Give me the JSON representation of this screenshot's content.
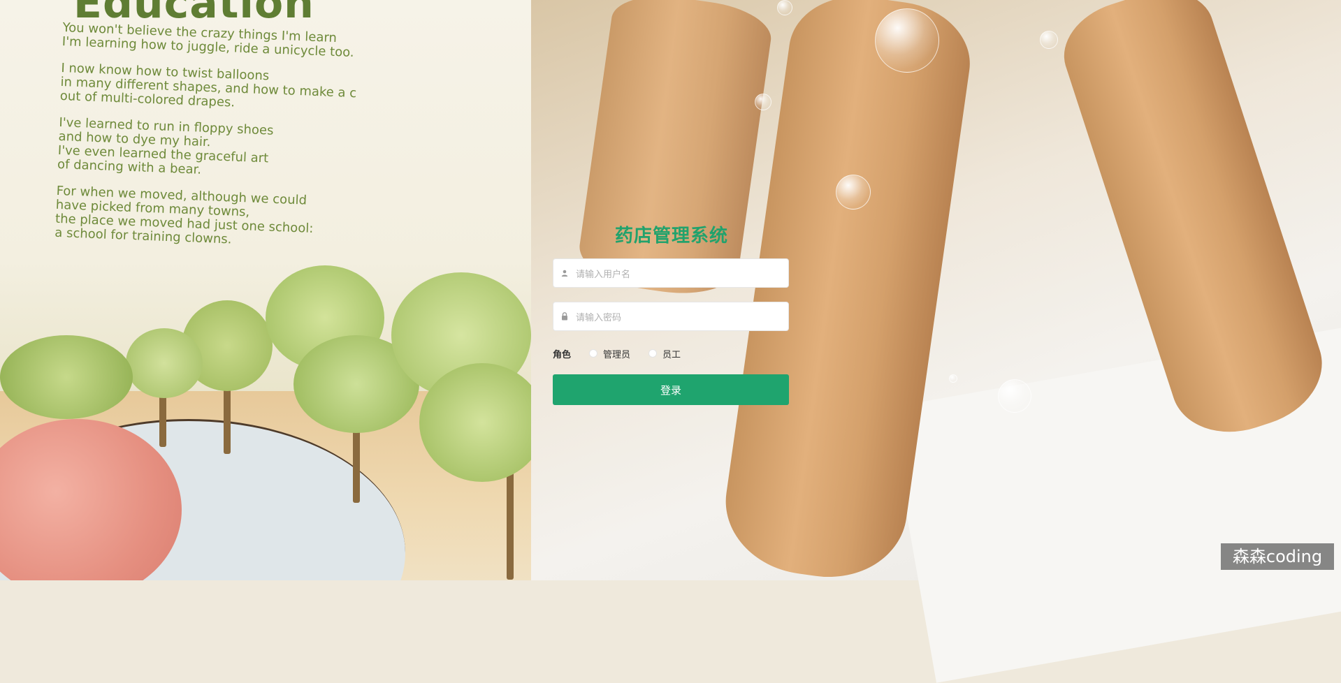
{
  "background": {
    "book_title": "Education",
    "poem": [
      "You won't believe the crazy things I'm learn\nI'm learning how to juggle, ride a unicycle too.",
      "I now know how to twist balloons\nin many different shapes, and how to make a c\nout of multi-colored drapes.",
      "I've learned to run in floppy shoes\nand how to dye my hair.\nI've even learned the graceful art\nof dancing with a bear.",
      "For when we moved, although we could\nhave picked from many towns,\nthe place we moved had just one school:\na school for training clowns."
    ]
  },
  "login": {
    "title": "药店管理系统",
    "username_placeholder": "请输入用户名",
    "username_value": "",
    "password_placeholder": "请输入密码",
    "password_value": "",
    "role_label": "角色",
    "roles": [
      "管理员",
      "员工"
    ],
    "submit_label": "登录"
  },
  "watermark": "森森coding",
  "colors": {
    "accent": "#1fa46e",
    "title": "#21a26c"
  }
}
